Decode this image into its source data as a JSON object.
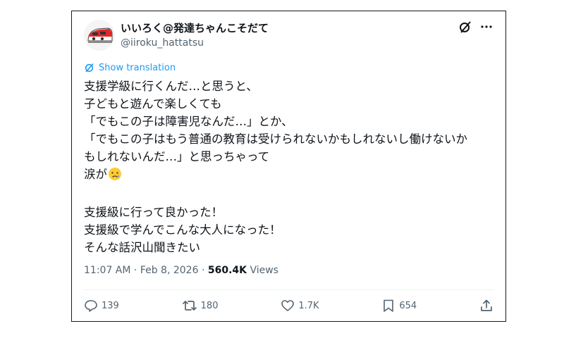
{
  "author": {
    "display_name": "いいろく@発達ちゃんこそだて",
    "handle": "@iiroku_hattatsu"
  },
  "translate": {
    "label": "Show translation"
  },
  "tweet": {
    "lines": [
      "支援学級に行くんだ…と思うと、",
      "子どもと遊んで楽しくても",
      "「でもこの子は障害児なんだ…」とか、",
      "「でもこの子はもう普通の教育は受けられないかもしれないし働けないか",
      "もしれないんだ…」と思っちゃって",
      "涙が"
    ],
    "lines2": [
      "支援級に行って良かった！",
      "支援級で学んでこんな大人になった！",
      "そんな話沢山聞きたい"
    ],
    "emoji": "crying-face"
  },
  "meta": {
    "time": "11:07 AM",
    "separator": "·",
    "date": "Feb 8, 2026",
    "views_count": "560.4K",
    "views_label": "Views"
  },
  "actions": {
    "replies": "139",
    "reposts": "180",
    "likes": "1.7K",
    "bookmarks": "654"
  },
  "colors": {
    "link": "#1d9bf0",
    "secondary": "#536471",
    "text": "#0f1419"
  }
}
